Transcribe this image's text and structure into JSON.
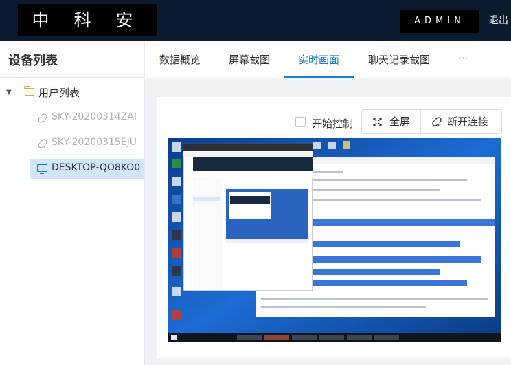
{
  "header": {
    "brand": "中 科 安 企",
    "user": "ADMIN",
    "logout": "退出"
  },
  "sidebar": {
    "title": "设备列表",
    "root": "用户列表",
    "devices": [
      {
        "label": "SKY-20200314ZAI",
        "status": "offline"
      },
      {
        "label": "SKY-20200315EJU",
        "status": "offline"
      },
      {
        "label": "DESKTOP-QO8KO0",
        "status": "online"
      }
    ]
  },
  "tabs": [
    {
      "label": "数据概览"
    },
    {
      "label": "屏幕截图"
    },
    {
      "label": "实时画面"
    },
    {
      "label": "聊天记录截图"
    },
    {
      "label": "···"
    }
  ],
  "active_tab": "实时画面",
  "controls": {
    "start_control": "开始控制",
    "fullscreen": "全屏",
    "disconnect": "断开连接"
  },
  "colors": {
    "header_bg": "#0b1a2e",
    "accent": "#1a7cd6",
    "selected_bg": "#cfe6fb"
  },
  "icons": {
    "fullscreen": "expand-arrows-icon",
    "disconnect": "broken-link-icon",
    "device_offline": "broken-link-icon",
    "device_online": "monitor-icon",
    "root": "folder-icon"
  }
}
